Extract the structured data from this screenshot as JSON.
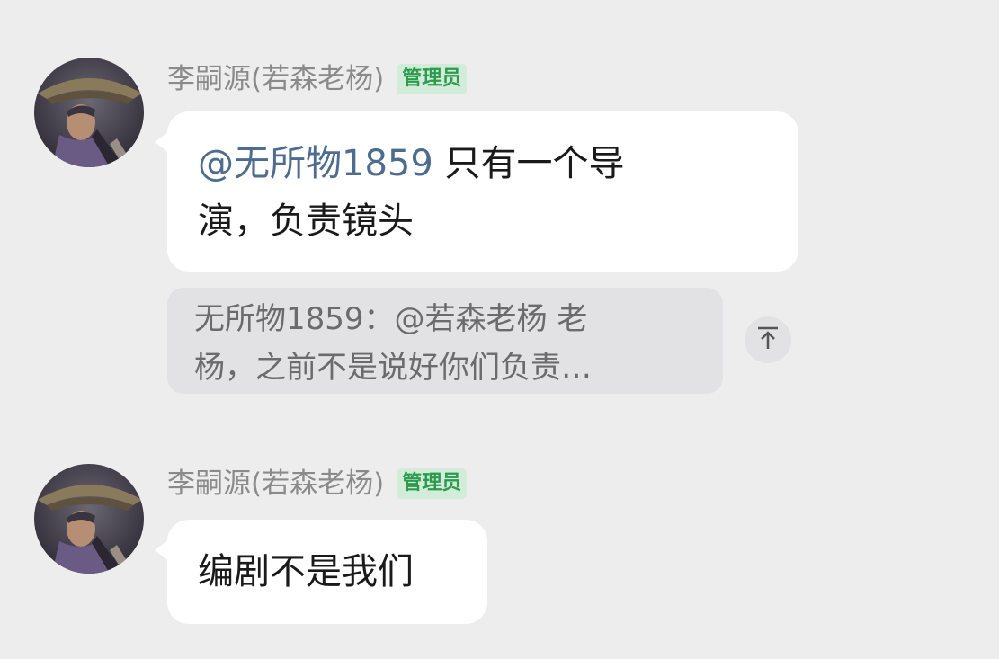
{
  "messages": [
    {
      "sender": "李嗣源(若森老杨)",
      "badge": "管理员",
      "mention": "@无所物1859",
      "text_line1_rest": " 只有一个导",
      "text_line2": "演，负责镜头",
      "quote": {
        "line1": "无所物1859：@若森老杨 老",
        "line2": "杨，之前不是说好你们负责…"
      },
      "quote_icon": "arrow-up-to-bar-icon"
    },
    {
      "sender": "李嗣源(若森老杨)",
      "badge": "管理员",
      "text": "编剧不是我们"
    }
  ],
  "colors": {
    "background": "#ededed",
    "bubble": "#ffffff",
    "mention": "#4e6c8e",
    "badge_bg": "#d3ecd9",
    "badge_text": "#2c9b4d",
    "quote_bg": "#e2e2e5"
  }
}
